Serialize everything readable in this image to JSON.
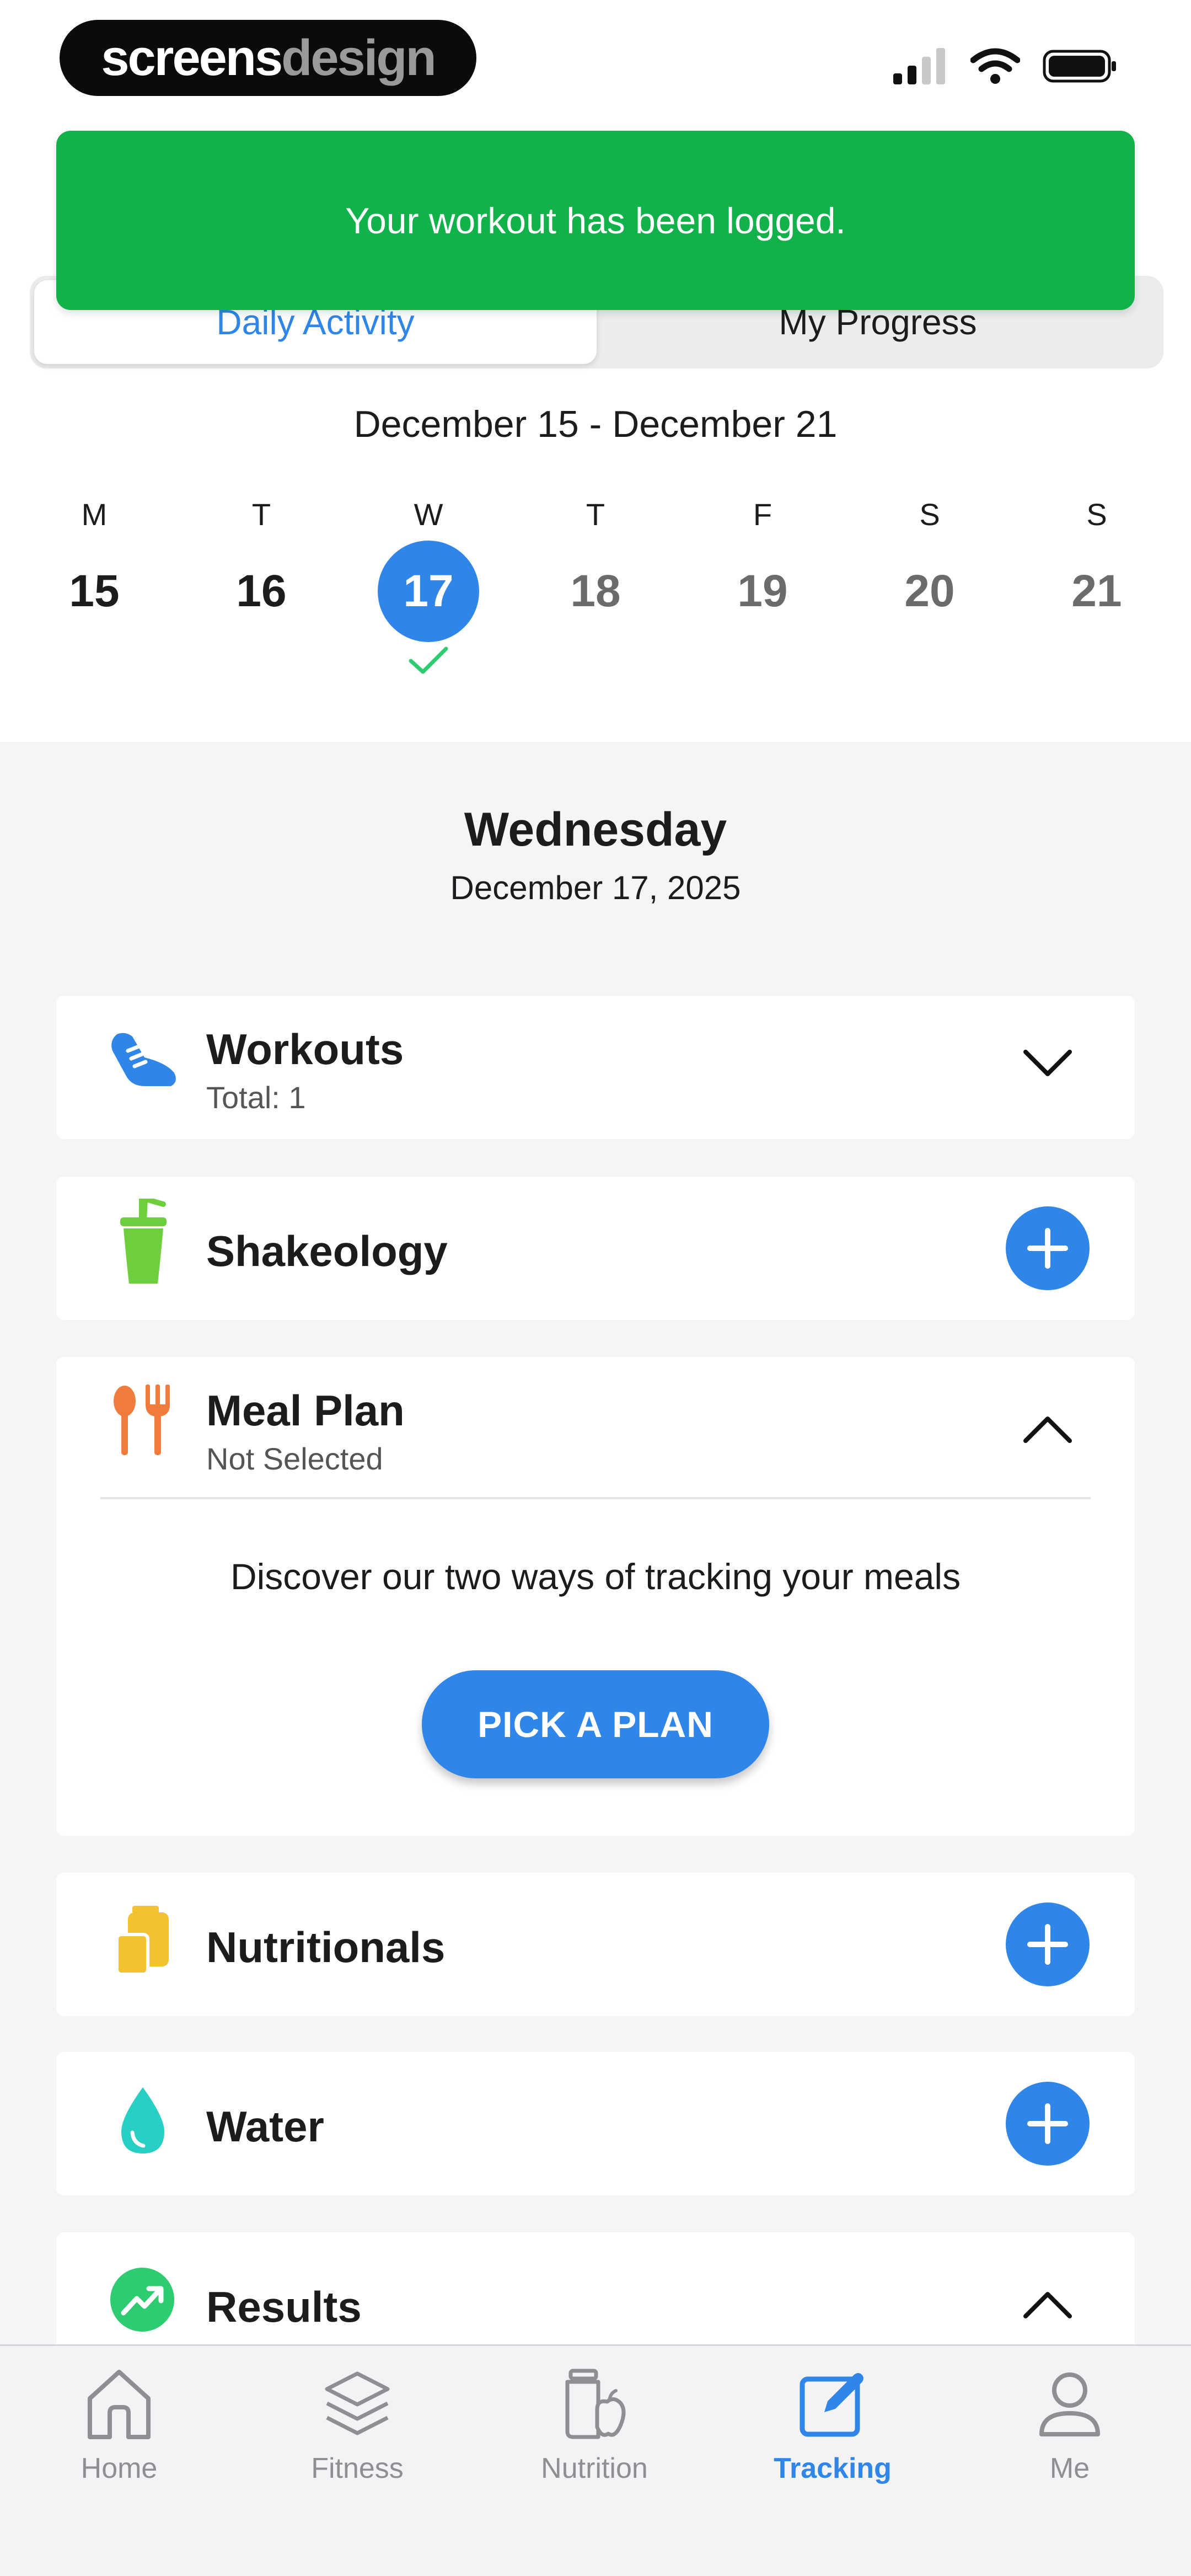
{
  "status_bar": {
    "brand_part1": "screens",
    "brand_part2": "design"
  },
  "toast": {
    "message": "Your workout has been logged."
  },
  "tabs": [
    {
      "label": "Daily Activity",
      "active": true
    },
    {
      "label": "My Progress",
      "active": false
    }
  ],
  "week": {
    "range": "December 15 - December 21",
    "days": [
      {
        "dow": "M",
        "num": "15"
      },
      {
        "dow": "T",
        "num": "16"
      },
      {
        "dow": "W",
        "num": "17"
      },
      {
        "dow": "T",
        "num": "18"
      },
      {
        "dow": "F",
        "num": "19"
      },
      {
        "dow": "S",
        "num": "20"
      },
      {
        "dow": "S",
        "num": "21"
      }
    ]
  },
  "day_header": {
    "weekday": "Wednesday",
    "date": "December 17, 2025"
  },
  "sections": {
    "workouts": {
      "title": "Workouts",
      "sub": "Total: 1"
    },
    "shakeology": {
      "title": "Shakeology"
    },
    "meal_plan": {
      "title": "Meal Plan",
      "sub": "Not Selected",
      "discover": "Discover our two ways of tracking your meals",
      "button": "PICK A PLAN"
    },
    "nutritionals": {
      "title": "Nutritionals"
    },
    "water": {
      "title": "Water"
    },
    "results": {
      "title": "Results"
    }
  },
  "nav": [
    {
      "label": "Home",
      "icon": "home-icon"
    },
    {
      "label": "Fitness",
      "icon": "layers-icon"
    },
    {
      "label": "Nutrition",
      "icon": "nutrition-icon"
    },
    {
      "label": "Tracking",
      "icon": "tracking-icon",
      "active": true
    },
    {
      "label": "Me",
      "icon": "person-icon"
    }
  ],
  "colors": {
    "accent": "#2f86e8",
    "toast": "#12b24a",
    "check": "#2ecc71"
  }
}
